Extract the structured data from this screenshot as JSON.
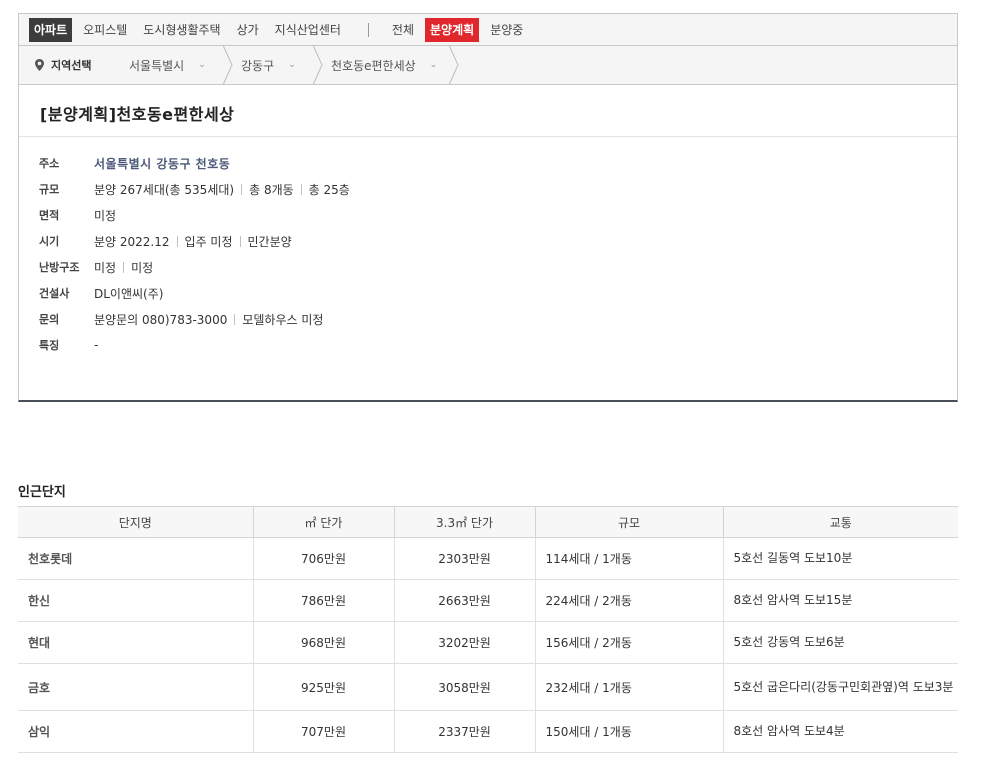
{
  "topnav": {
    "types": [
      {
        "label": "아파트",
        "active": true
      },
      {
        "label": "오피스텔"
      },
      {
        "label": "도시형생활주택"
      },
      {
        "label": "상가"
      },
      {
        "label": "지식산업센터"
      }
    ],
    "status": [
      {
        "label": "전체"
      },
      {
        "label": "분양계획",
        "active": true
      },
      {
        "label": "분양중"
      }
    ]
  },
  "region": {
    "label": "지역선택",
    "crumbs": [
      "서울특별시",
      "강동구",
      "천호동e편한세상"
    ]
  },
  "detail": {
    "title": "[분양계획]천호동e편한세상",
    "rows": [
      {
        "key": "주소",
        "values": [
          "서울특별시 강동구 천호동"
        ]
      },
      {
        "key": "규모",
        "values": [
          "분양 267세대(총 535세대)",
          "총 8개동",
          "총 25층"
        ]
      },
      {
        "key": "면적",
        "values": [
          "미정"
        ]
      },
      {
        "key": "시기",
        "values": [
          "분양 2022.12",
          "입주 미정",
          "민간분양"
        ]
      },
      {
        "key": "난방구조",
        "values": [
          "미정",
          "미정"
        ]
      },
      {
        "key": "건설사",
        "values": [
          "DL이앤씨(주)"
        ]
      },
      {
        "key": "문의",
        "values": [
          "분양문의 080)783-3000",
          "모델하우스 미정"
        ]
      },
      {
        "key": "특징",
        "values": [
          "-"
        ]
      }
    ]
  },
  "nearby": {
    "title": "인근단지",
    "headers": [
      "단지명",
      "㎡ 단가",
      "3.3㎡ 단가",
      "규모",
      "교통"
    ],
    "rows": [
      [
        "천호롯데",
        "706만원",
        "2303만원",
        "114세대 / 1개동",
        "5호선 길동역 도보10분"
      ],
      [
        "한신",
        "786만원",
        "2663만원",
        "224세대 / 2개동",
        "8호선 암사역 도보15분"
      ],
      [
        "현대",
        "968만원",
        "3202만원",
        "156세대 / 2개동",
        "5호선 강동역 도보6분"
      ],
      [
        "금호",
        "925만원",
        "3058만원",
        "232세대 / 1개동",
        "5호선 굽은다리(강동구민회관옆)역 도보3분"
      ],
      [
        "삼익",
        "707만원",
        "2337만원",
        "150세대 / 1개동",
        "8호선 암사역 도보4분"
      ]
    ]
  },
  "colors": {
    "active_type": "#3c3c3c",
    "active_status": "#e0272b",
    "address": "#4d5a7a"
  }
}
